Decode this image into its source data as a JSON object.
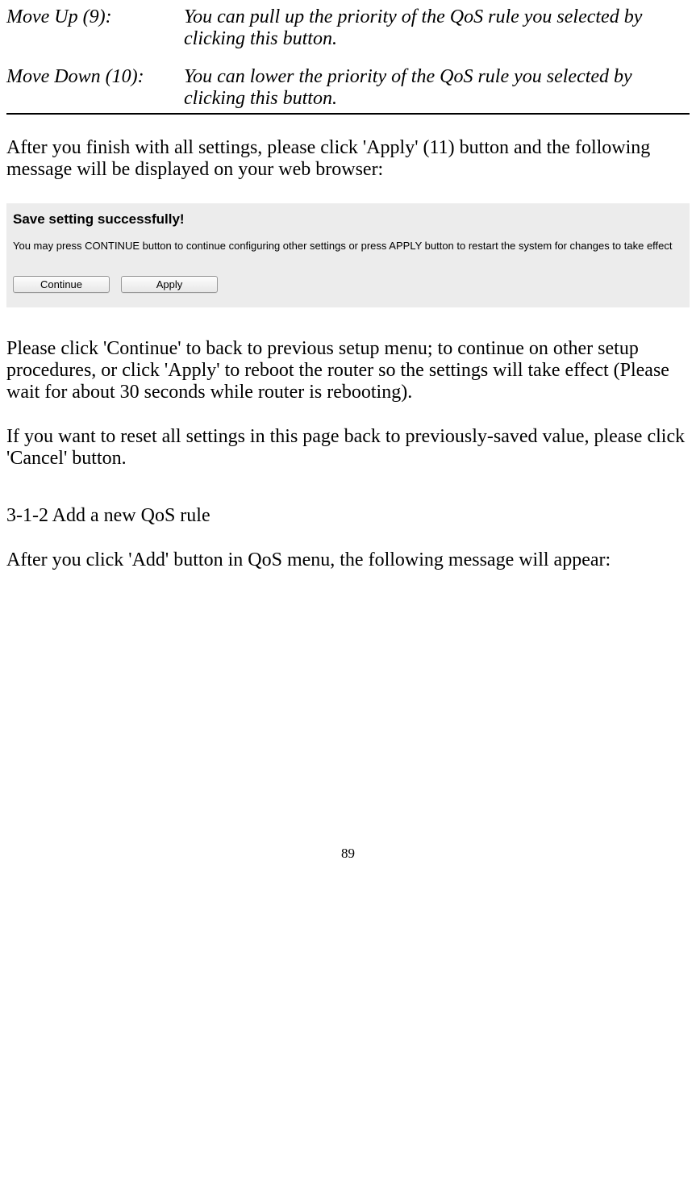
{
  "definitions": [
    {
      "term": "Move Up (9):",
      "desc": "You can pull up the priority of the QoS rule you selected by clicking this button."
    },
    {
      "term": "Move Down (10):",
      "desc": "You can lower the priority of the QoS rule you selected by clicking this button."
    }
  ],
  "para1": "After you finish with all settings, please click 'Apply' (11) button and the following message will be displayed on your web browser:",
  "dialog": {
    "title": "Save setting successfully!",
    "text": "You may press CONTINUE button to continue configuring other settings or press APPLY button to restart the system for changes to take effect",
    "continue_label": "Continue",
    "apply_label": "Apply"
  },
  "para2": "Please click 'Continue' to back to previous setup menu; to continue on other setup procedures, or click 'Apply' to reboot the router so the settings will take effect (Please wait for about 30 seconds while router is rebooting).",
  "para3": "If you want to reset all settings in this page back to previously-saved value, please click 'Cancel' button.",
  "section_heading": "3-1-2 Add a new QoS rule",
  "para4": "After you click 'Add' button in QoS menu, the following message will appear:",
  "page_number": "89"
}
